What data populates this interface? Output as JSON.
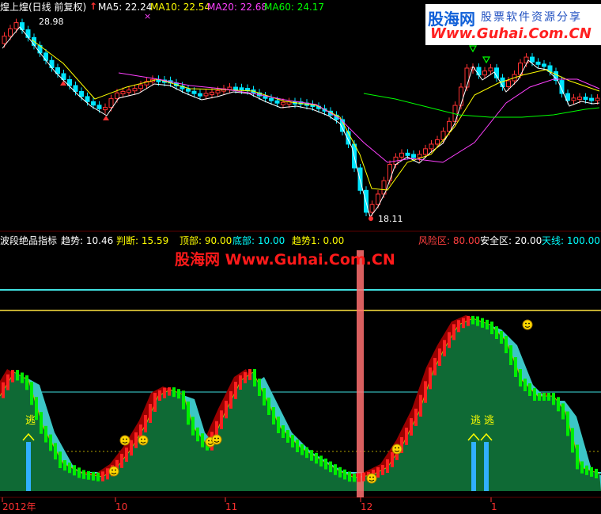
{
  "colors": {
    "bg": "#000000",
    "up": "#ff3232",
    "down": "#00e5ff",
    "ma5": "#ffffff",
    "ma10": "#ffff00",
    "ma20": "#ff40ff",
    "ma60": "#00ff00",
    "risk": "#ff4040",
    "safe": "#ffffff",
    "sky": "#00ffff",
    "area_green": "#0f6a35",
    "area_cyan": "#3cc6c6",
    "area_red": "#9a0000",
    "brick_green": "#00ee00",
    "brick_red": "#ff2020",
    "line_cyan": "#40e0e0",
    "line_yellow": "#ffe640",
    "date": "#ff3030"
  },
  "top_panel": {
    "title": "煌上煌(日线 前复权)",
    "arrow_glyph": "↑",
    "ma5_label": "MA5: 22.24",
    "ma10_label": "MA10: 22.54",
    "ma20_label": "MA20: 22.68",
    "ma60_label": "MA60: 24.17",
    "marker_glyph": "×",
    "high_price": "28.98",
    "low_price": "18.11"
  },
  "indicator_panel": {
    "name": "波段绝品指标",
    "trend_label": "趋势: 10.46",
    "judge_label": "判断: 15.59",
    "top_label": "顶部: 90.00",
    "bottom_label": "底部: 10.00",
    "trend1_label": "趋势1: 0.00",
    "risk_label": "风险区: 80.00",
    "safe_label": "安全区: 20.00",
    "sky_label": "天线: 100.00",
    "escape_text": "逃"
  },
  "watermark": {
    "logo": "股海网",
    "tagline": "股票软件资源分享",
    "url": "Www.Guhai.Com.CN",
    "center": "股海网 Www.Guhai.Com.CN"
  },
  "x_axis": {
    "labels": [
      "2012年",
      "10",
      "11",
      "12",
      "1"
    ]
  },
  "chart_data": [
    {
      "type": "candlestick",
      "title": "煌上煌(日线 前复权)",
      "series": [
        {
          "name": "MA5",
          "last": 22.24
        },
        {
          "name": "MA10",
          "last": 22.54
        },
        {
          "name": "MA20",
          "last": 22.68
        },
        {
          "name": "MA60",
          "last": 24.17
        }
      ],
      "annotations": [
        {
          "text": "28.98",
          "meaning": "period high"
        },
        {
          "text": "18.11",
          "meaning": "period low"
        }
      ],
      "x_tick_labels": [
        "2012年",
        "10",
        "11",
        "12",
        "1"
      ]
    },
    {
      "type": "area",
      "title": "波段绝品指标",
      "readouts": {
        "趋势": 10.46,
        "判断": 15.59,
        "顶部": 90.0,
        "底部": 10.0,
        "趋势1": 0.0
      },
      "levels": [
        {
          "name": "风险区",
          "value": 80.0
        },
        {
          "name": "安全区",
          "value": 20.0
        },
        {
          "name": "天线",
          "value": 100.0
        }
      ]
    }
  ]
}
